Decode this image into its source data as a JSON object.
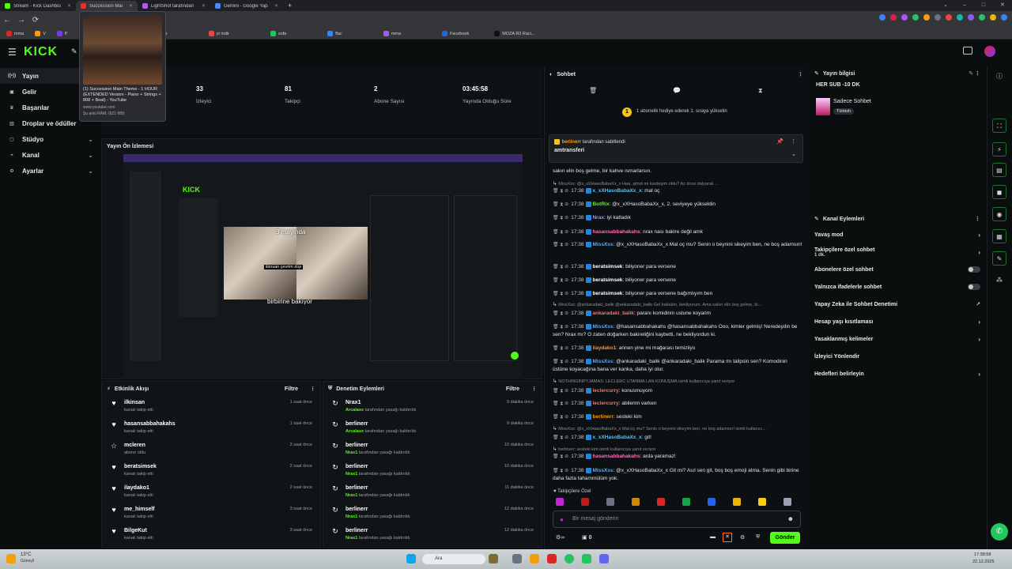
{
  "browser": {
    "tabs": [
      {
        "title": "Stream - Kick Dashboard",
        "color": "#53fc18",
        "active": false
      },
      {
        "title": "Succession Main Theme",
        "color": "#e03131",
        "active": true
      },
      {
        "title": "LightShot tarafından Ekran",
        "color": "#a55eea",
        "active": false
      },
      {
        "title": "Gemini - Google Yapay Zek",
        "color": "#4c8bf5",
        "active": false
      }
    ],
    "new_tab": "+",
    "bookmarks": [
      "mma",
      "V",
      "P",
      "alt riba",
      "canlı skor",
      "yt indir",
      "sofa",
      "flac",
      "mma",
      "Facebook",
      "MOZA R3 Raci..."
    ]
  },
  "hovercard": {
    "title": "(1) Succession Main Theme - 1 HOUR (EXTENDED Version - Piano + Strings + 808 + Beat) - YouTube",
    "url": "www.youtube.com",
    "ram": "Şu anki RAM: (621 MB)"
  },
  "sidebar": {
    "items": [
      {
        "label": "Yayın",
        "icon": "broadcast-icon",
        "chev": false,
        "active": true
      },
      {
        "label": "Gelir",
        "icon": "wallet-icon",
        "chev": false,
        "active": false
      },
      {
        "label": "Başarılar",
        "icon": "trophy-icon",
        "chev": false,
        "active": false
      },
      {
        "label": "Droplar ve ödüller",
        "icon": "gift-icon",
        "chev": false,
        "active": false
      },
      {
        "label": "Stüdyo",
        "icon": "folder-icon",
        "chev": true,
        "active": false
      },
      {
        "label": "Kanal",
        "icon": "user-icon",
        "chev": true,
        "active": false
      },
      {
        "label": "Ayarlar",
        "icon": "gear-icon",
        "chev": true,
        "active": false
      }
    ]
  },
  "stats": [
    {
      "value": "33",
      "label": "İzleyici"
    },
    {
      "value": "81",
      "label": "Takipçi"
    },
    {
      "value": "2",
      "label": "Abone Sayısı"
    },
    {
      "value": "03:45:58",
      "label": "Yayında Olduğu Süre"
    }
  ],
  "preview": {
    "title": "Yayın Ön İzlemesi",
    "captions": [
      "3 mayında",
      "ikinsan çevrim dışı",
      "birbirine bakıyor"
    ]
  },
  "events": {
    "title": "Etkinlik Akışı",
    "filter": "Filtre",
    "items": [
      {
        "name": "ilkinsan",
        "sub": "kanalı takip etti",
        "time": "1 saat önce",
        "icon": "heart-icon"
      },
      {
        "name": "hasansabbahakahs",
        "sub": "kanalı takip etti",
        "time": "1 saat önce",
        "icon": "heart-icon"
      },
      {
        "name": "mcleren",
        "sub": "abone oldu",
        "time": "2 saat önce",
        "icon": "star-icon"
      },
      {
        "name": "beratsimsek",
        "sub": "kanalı takip etti",
        "time": "2 saat önce",
        "icon": "heart-icon"
      },
      {
        "name": "ilaydako1",
        "sub": "kanalı takip etti",
        "time": "2 saat önce",
        "icon": "heart-icon"
      },
      {
        "name": "me_himself",
        "sub": "kanalı takip etti",
        "time": "3 saat önce",
        "icon": "heart-icon"
      },
      {
        "name": "BilgeKut",
        "sub": "kanalı takip etti",
        "time": "3 saat önce",
        "icon": "heart-icon"
      }
    ]
  },
  "modlog": {
    "title": "Denetim Eylemleri",
    "filter": "Filtre",
    "items": [
      {
        "name": "Nrax1",
        "by": "Arcalasx",
        "sub": "tarafından yasağı kaldırıldı",
        "time": "9 dakika önce"
      },
      {
        "name": "berlinerr",
        "by": "Arcalasx",
        "sub": "tarafından yasağı kaldırıldı",
        "time": "9 dakika önce"
      },
      {
        "name": "berlinerr",
        "by": "Nrax1",
        "sub": "tarafından yasağı kaldırıldı",
        "time": "10 dakika önce"
      },
      {
        "name": "berlinerr",
        "by": "Nrax1",
        "sub": "tarafından yasağı kaldırıldı",
        "time": "10 dakika önce"
      },
      {
        "name": "berlinerr",
        "by": "Nrax1",
        "sub": "tarafından yasağı kaldırıldı",
        "time": "11 dakika önce"
      },
      {
        "name": "berlinerr",
        "by": "Nrax1",
        "sub": "tarafından yasağı kaldırıldı",
        "time": "12 dakika önce"
      },
      {
        "name": "berlinerr",
        "by": "Nrax1",
        "sub": "tarafından yasağı kaldırıldı",
        "time": "12 dakika önce"
      }
    ]
  },
  "chat": {
    "title": "Sohbet",
    "gift_note": "1 abonelik hediye ederek 1. sıraya yükselin",
    "pinned_by": "berlinerr",
    "pinned_suffix": "tarafından sabitlendi",
    "pinned_text": "amtransferi",
    "messages": [
      {
        "type": "text",
        "text": "sakın elin boş gelme, bir kahve ısmarlarsın."
      },
      {
        "type": "reply",
        "text": "MissXss: @x_xXHasoBabaXx_x Haa, şimdi mi kardeşim oldu? Az önce dalyarak ..."
      },
      {
        "time": "17:38",
        "user": "x_xXHasoBabaXx_x",
        "color": "#4fc3f7",
        "text": "mal oç"
      },
      {
        "time": "17:38",
        "user": "BotRix",
        "color": "#53fc18",
        "text": "@x_xXHasoBabaXx_x, 2. seviyeye yükseldin"
      },
      {
        "time": "17:38",
        "user": "Nrax",
        "color": "#a78bfa",
        "text": "iyi katladık"
      },
      {
        "time": "17:38",
        "user": "hasansabbahakahs",
        "color": "#f472b6",
        "text": "nrax nası bakire değil amk"
      },
      {
        "time": "17:38",
        "user": "MissXss",
        "color": "#60a5fa",
        "text": "@x_xXHasoBabaXx_x Mal oç mu? Senin o beynini sikeyim ben, ne boş adamsın!"
      },
      {
        "time": "17:38",
        "user": "beratsimsek",
        "color": "#ffffff",
        "text": "biliyoner para versene"
      },
      {
        "time": "17:38",
        "user": "beratsimsek",
        "color": "#ffffff",
        "text": "biliyoner para versene"
      },
      {
        "time": "17:38",
        "user": "beratsimsek",
        "color": "#ffffff",
        "text": "biliyoner para versene bağımlıyım ben"
      },
      {
        "type": "reply",
        "text": "MissXss: @ankaradaki_balik @ankaradaki_balik Gel bakalım, bekliyorum. Ama sakın elin boş gelme, bi..."
      },
      {
        "time": "17:38",
        "user": "ankaradaki_balik",
        "color": "#f87171",
        "text": "paranı komidinin ustune koyarim"
      },
      {
        "time": "17:38",
        "user": "MissXss",
        "color": "#60a5fa",
        "text": "@hasansabbahakahs @hasansabbahakahs Ooo, kimler gelmiş! Neredeydin be sen? Nrax mı? O zaten doğarken bakireliğini kaybetti, ne bekliyordun ki."
      },
      {
        "time": "17:38",
        "user": "ilaydako1",
        "color": "#fb923c",
        "text": "annen yine mi mağarası temizliyo"
      },
      {
        "time": "17:38",
        "user": "MissXss",
        "color": "#60a5fa",
        "text": "@ankaradaki_balik @ankaradaki_balik Parama mı talipsin sen? Komodinin üstüne koyacağına bana ver kanka, daha iyi olur."
      },
      {
        "type": "reply",
        "text": "NOTHINGINPYJAMAS: LECLERC UTANMA LAN KONUŞMA isimli kullanıcıya yanıt veriyor"
      },
      {
        "time": "17:38",
        "user": "leclercurry",
        "color": "#f87171",
        "text": "konusmuyom"
      },
      {
        "time": "17:38",
        "user": "leclercurry",
        "color": "#f87171",
        "text": "abilerim varken"
      },
      {
        "time": "17:38",
        "user": "berlinerr",
        "color": "#f59e0b",
        "text": "sesteki kim"
      },
      {
        "type": "reply",
        "text": "MissXss: @x_xXHasoBabaXx_x Mal oç mu? Senin o beynini sikeyim ben, ne boş adamsın! isimli kullanıcı..."
      },
      {
        "time": "17:38",
        "user": "x_xXHasoBabaXx_x",
        "color": "#4fc3f7",
        "text": "git!"
      },
      {
        "type": "reply",
        "text": "berlinerr: sesteki kim isimli kullanıcıya yanıt veriyor"
      },
      {
        "time": "17:38",
        "user": "hasansabbahakahs",
        "color": "#f472b6",
        "text": "arda yaramaz!"
      },
      {
        "time": "17:38",
        "user": "MissXss",
        "color": "#60a5fa",
        "text": "@x_xXHasoBabaXx_x Git mi? Asıl sen git, boş boş emoji atma. Senin gibi birine daha fazla tahammülüm yok."
      }
    ],
    "followers_only": "Takipçilere Özel",
    "input_placeholder": "Bir mesaj gönderin",
    "count": "0",
    "send": "Gönder"
  },
  "stream_info": {
    "title": "Yayın bilgisi",
    "stream_title": "HER SUB -10 DK",
    "category": "Sadece Sohbet",
    "tag": "Türkish"
  },
  "channel_actions": {
    "title": "Kanal Eylemleri",
    "items": [
      {
        "label": "Yavaş mod",
        "kind": "chev"
      },
      {
        "label": "Takipçilere özel sohbet",
        "sub": "1 dk.",
        "kind": "chev"
      },
      {
        "label": "Abonelere özel sohbet",
        "kind": "toggle"
      },
      {
        "label": "Yalnızca ifadelerle sohbet",
        "kind": "toggle"
      },
      {
        "label": "Yapay Zeka ile Sohbet Denetimi",
        "kind": "ext"
      },
      {
        "label": "Hesap yaşı kısıtlaması",
        "kind": "chev"
      },
      {
        "label": "Yasaklanmış kelimeler",
        "kind": "chev"
      },
      {
        "label": "İzleyici Yönlendir",
        "kind": "none"
      },
      {
        "label": "Hedefleri belirleyin",
        "kind": "chev"
      }
    ]
  },
  "taskbar": {
    "weather": "13°C",
    "weather_sub": "Güneşli",
    "search": "Ara",
    "time": "17:38:58",
    "date": "22.12.2025"
  },
  "colors": {
    "accent": "#53fc18",
    "bg": "#0b0e0f",
    "panel": "#111416"
  }
}
